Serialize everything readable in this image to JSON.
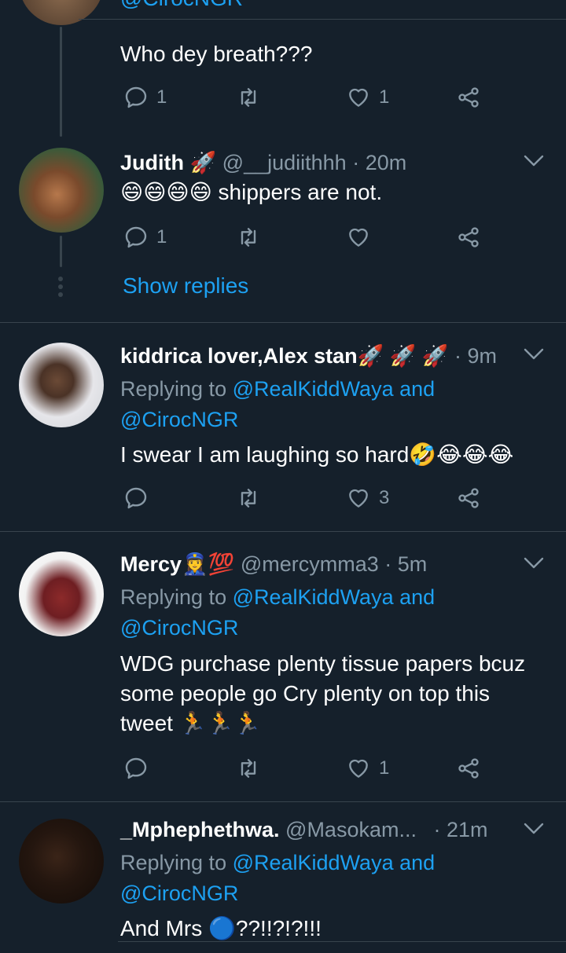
{
  "colors": {
    "background": "#15202b",
    "text": "#ffffff",
    "muted": "#8899a6",
    "link": "#1da1f2",
    "divider": "#38444d"
  },
  "tweet0": {
    "top_handle_partial": "@CirocNGR",
    "text": "Who dey breath???",
    "reply_count": "1",
    "like_count": "1"
  },
  "tweet1": {
    "name": "Judith",
    "name_emoji": "🚀",
    "handle": "@__judiithhh",
    "time": "· 20m",
    "text_emoji": "😄😄😄😄",
    "text": " shippers are not.",
    "reply_count": "1",
    "like_count": "",
    "show_replies": "Show replies"
  },
  "tweet2": {
    "name": "kiddrica lover,Alex stan",
    "name_emoji": "🚀 🚀 🚀",
    "time": "· 9m",
    "replying_prefix": "Replying to ",
    "replying_to_1": "@RealKiddWaya",
    "and": " and",
    "replying_to_2": "@CirocNGR",
    "text": "I swear I am laughing so hard",
    "text_emoji": "🤣😂😂😂",
    "reply_count": "",
    "like_count": "3"
  },
  "tweet3": {
    "name": "Mercy",
    "name_emoji": "👮‍♀️💯",
    "handle": "@mercymma3",
    "time": "· 5m",
    "replying_prefix": "Replying to ",
    "replying_to_1": "@RealKiddWaya",
    "and": " and",
    "replying_to_2": "@CirocNGR",
    "text_line1": "WDG purchase plenty tissue papers bcuz",
    "text_line2": "some people go Cry plenty on top this",
    "text_line3": "tweet ",
    "text_emoji": "🏃🏃🏃",
    "reply_count": "",
    "like_count": "1"
  },
  "tweet4": {
    "name": "_Mphephethwa.",
    "handle": "@Masokam...",
    "time": "· 21m",
    "replying_prefix": "Replying to ",
    "replying_to_1": "@RealKiddWaya",
    "and": " and",
    "replying_to_2": "@CirocNGR",
    "text": "And Mrs ",
    "text_emoji": "🔵",
    "text_suffix": "??!!?!?!!!"
  },
  "icons": [
    "reply-icon",
    "retweet-icon",
    "like-icon",
    "share-icon",
    "chevron-down-icon"
  ]
}
